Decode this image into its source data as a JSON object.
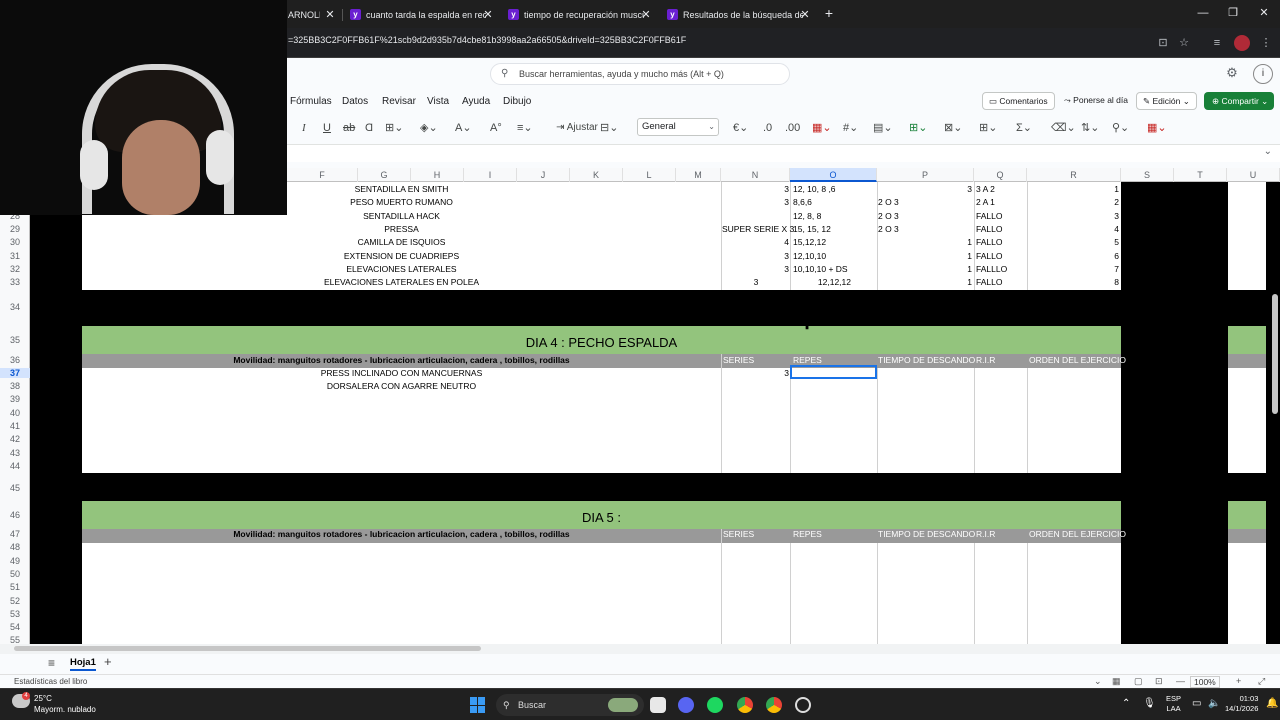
{
  "browser": {
    "tabs": [
      {
        "title": "ARNOLD"
      },
      {
        "title": "cuanto tarda la espalda en recu"
      },
      {
        "title": "tiempo de recuperación muscu"
      },
      {
        "title": "Resultados de la búsqueda de"
      }
    ],
    "url": "=325BB3C2F0FFB61F%21scb9d2d935b7d4cbe81b3998aa2a66505&driveId=325BB3C2F0FFB61F"
  },
  "sheets": {
    "search_placeholder": "Buscar herramientas, ayuda y mucho más (Alt + Q)",
    "menu": [
      "Fórmulas",
      "Datos",
      "Revisar",
      "Vista",
      "Ayuda",
      "Dibujo"
    ],
    "comments_label": "Comentarios",
    "catchup_label": "Ponerse al día",
    "edit_mode_label": "Edición",
    "share_label": "Compartir",
    "wrap_label": "Ajustar",
    "number_format": "General",
    "columns": [
      "F",
      "G",
      "H",
      "I",
      "J",
      "K",
      "L",
      "M",
      "N",
      "O",
      "P",
      "Q",
      "R",
      "S",
      "T",
      "U"
    ],
    "selected_column": "O",
    "selected_row": "37",
    "rows_upper": [
      {
        "num": "",
        "exercise": "SENTADILLA EN SMITH",
        "n": "3",
        "o": "12, 10, 8 ,6",
        "p": "",
        "p_r": "3",
        "q": "3 A 2",
        "r": "1"
      },
      {
        "num": "",
        "exercise": "PESO MUERTO RUMANO",
        "n": "3",
        "o": "8,6,6",
        "p": "2 O 3",
        "p_r": "",
        "q": "2 A 1",
        "r": "2"
      },
      {
        "num": "28",
        "exercise": "SENTADILLA HACK",
        "n": "",
        "o": "12, 8, 8",
        "p": "2 O 3",
        "p_r": "",
        "q": "FALLO",
        "r": "3"
      },
      {
        "num": "29",
        "exercise": "PRESSA",
        "n": "SUPER SERIE X 3",
        "o": "15, 15, 12",
        "p": "2 O 3",
        "p_r": "",
        "q": "FALLO",
        "r": "4"
      },
      {
        "num": "30",
        "exercise": "CAMILLA DE ISQUIOS",
        "n": "4",
        "o": "15,12,12",
        "p": "",
        "p_r": "1",
        "q": "FALLO",
        "r": "5"
      },
      {
        "num": "31",
        "exercise": "EXTENSION DE CUADRIEPS",
        "n": "3",
        "o": "12,10,10",
        "p": "",
        "p_r": "1",
        "q": "FALLO",
        "r": "6"
      },
      {
        "num": "32",
        "exercise": "ELEVACIONES LATERALES",
        "n": "3",
        "o": "10,10,10 + DS",
        "p": "",
        "p_r": "1",
        "q": "FALLLO",
        "r": "7"
      },
      {
        "num": "33",
        "exercise": "ELEVACIONES LATERALES EN POLEA",
        "n": "3",
        "o": "12,12,12",
        "p": "",
        "p_r": "1",
        "q": "FALLO",
        "r": "8"
      }
    ],
    "day4": {
      "title": "DIA 4 :  PECHO ESPALDA",
      "mobility": "Movilidad: manguitos rotadores - lubricacion articulacion, cadera , tobillos, rodillas",
      "headers": [
        "SERIES",
        "REPES",
        "TIEMPO DE DESCANDO",
        "R.I.R",
        "ORDEN DEL EJERCICIO"
      ],
      "exercises": [
        {
          "name": "PRESS INCLINADO CON MANCUERNAS",
          "series": "3"
        },
        {
          "name": "DORSALERA CON AGARRE NEUTRO",
          "series": ""
        }
      ]
    },
    "day5": {
      "title": "DIA 5 :",
      "mobility": "Movilidad: manguitos rotadores - lubricacion articulacion, cadera , tobillos, rodillas",
      "headers": [
        "SERIES",
        "REPES",
        "TIEMPO DE DESCANDO",
        "R.I.R",
        "ORDEN DEL EJERCICIO"
      ]
    },
    "row_numbers": [
      "28",
      "29",
      "30",
      "31",
      "32",
      "33",
      "34",
      "35",
      "36",
      "37",
      "38",
      "39",
      "40",
      "41",
      "42",
      "43",
      "44",
      "45",
      "46",
      "47",
      "48",
      "49",
      "50",
      "51",
      "52",
      "53",
      "54",
      "55"
    ],
    "sheet_tab": "Hoja1",
    "stats_label": "Estadísticas del libro",
    "zoom": "100%"
  },
  "taskbar": {
    "weather_temp": "25°C",
    "weather_desc": "Mayorm. nublado",
    "weather_badge": "4",
    "search_label": "Buscar",
    "lang_1": "ESP",
    "lang_2": "LAA",
    "time": "01:03",
    "date": "14/1/2026"
  }
}
